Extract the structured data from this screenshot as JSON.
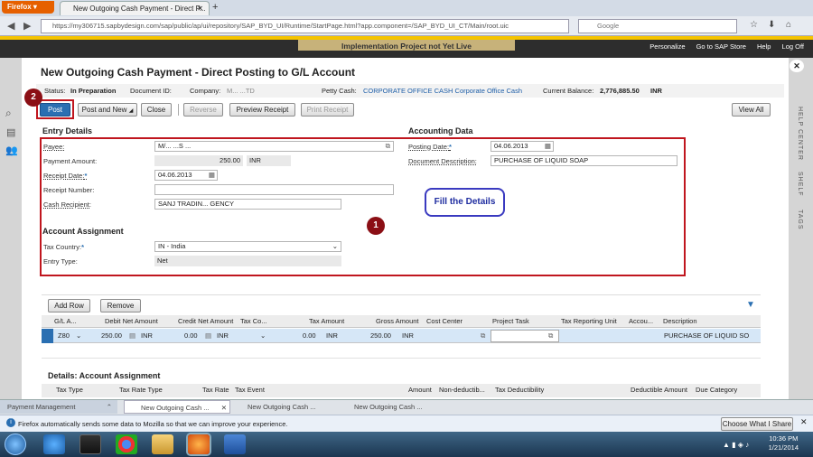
{
  "browser": {
    "app_button": "Firefox",
    "tab_title": "New Outgoing Cash Payment - Direct P...",
    "new_tab": "+",
    "url": "https://my306715.sapbydesign.com/sap/public/ap/ui/repository/SAP_BYD_UI/Runtime/StartPage.html?app.component=/SAP_BYD_UI_CT/Main/root.uic",
    "search_placeholder": "Google"
  },
  "sap_header": {
    "banner": "Implementation Project not Yet Live",
    "links": [
      "Personalize",
      "Go to SAP Store",
      "Help",
      "Log Off"
    ]
  },
  "side_right": [
    "HELP CENTER",
    "SHELF",
    "TAGS"
  ],
  "page": {
    "title": "New Outgoing Cash Payment - Direct Posting to G/L Account",
    "status_label": "Status:",
    "status_value": "In Preparation",
    "docid_label": "Document ID:",
    "company_label": "Company:",
    "company_value": "M...                ...TD",
    "pettycash_label": "Petty Cash:",
    "pettycash_value": "CORPORATE OFFICE CASH Corporate Office Cash",
    "balance_label": "Current Balance:",
    "balance_value": "2,776,885.50",
    "balance_currency": "INR"
  },
  "toolbar": {
    "post": "Post",
    "post_and_new": "Post and New",
    "close": "Close",
    "reverse": "Reverse",
    "preview_receipt": "Preview Receipt",
    "print_receipt": "Print Receipt",
    "view_all": "View All"
  },
  "entry_details": {
    "heading": "Entry Details",
    "payee_label": "Payee:",
    "payee_value": "M/...    ...S ...",
    "amount_label": "Payment Amount:",
    "amount_value": "250.00",
    "amount_currency": "INR",
    "receipt_date_label": "Receipt Date:",
    "receipt_date_value": "04.06.2013",
    "receipt_number_label": "Receipt Number:",
    "cash_recipient_label": "Cash Recipient:",
    "cash_recipient_value": "SANJ TRADIN... GENCY"
  },
  "accounting_data": {
    "heading": "Accounting Data",
    "posting_date_label": "Posting Date:",
    "posting_date_value": "04.06.2013",
    "doc_desc_label": "Document Description:",
    "doc_desc_value": "PURCHASE OF LIQUID SOAP"
  },
  "account_assignment": {
    "heading": "Account Assignment",
    "tax_country_label": "Tax Country:",
    "tax_country_value": "IN - India",
    "entry_type_label": "Entry Type:",
    "entry_type_value": "Net"
  },
  "annotation": {
    "callout": "Fill the Details",
    "marker1": "1",
    "marker2": "2"
  },
  "table": {
    "add_row": "Add Row",
    "remove": "Remove",
    "columns": [
      "G/L A...",
      "Debit Net Amount",
      "Credit Net Amount",
      "Tax Co...",
      "Tax Amount",
      "Gross Amount",
      "Cost Center",
      "Project Task",
      "Tax Reporting Unit",
      "Accou...",
      "Description"
    ],
    "row": {
      "gl": "Z80",
      "debit": "250.00",
      "debit_cur": "INR",
      "credit": "0.00",
      "credit_cur": "INR",
      "tax_amount": "0.00",
      "tax_cur": "INR",
      "gross": "250.00",
      "gross_cur": "INR",
      "description": "PURCHASE OF LIQUID SO"
    }
  },
  "details_assignment": {
    "heading": "Details: Account Assignment",
    "columns": [
      "Tax Type",
      "Tax Rate Type",
      "Tax Rate",
      "Tax Event",
      "Amount",
      "Non-deductib...",
      "Tax Deductibility",
      "Deductible Amount",
      "Due Category"
    ]
  },
  "taskbar_tabs": {
    "payment_management": "Payment Management",
    "tab1": "New Outgoing Cash ...",
    "tab2": "New Outgoing Cash ...",
    "tab3": "New Outgoing Cash ..."
  },
  "notification": {
    "text": "Firefox automatically sends some data to Mozilla so that we can improve your experience.",
    "button": "Choose What I Share"
  },
  "clock": {
    "time": "10:36 PM",
    "date": "1/21/2014"
  }
}
